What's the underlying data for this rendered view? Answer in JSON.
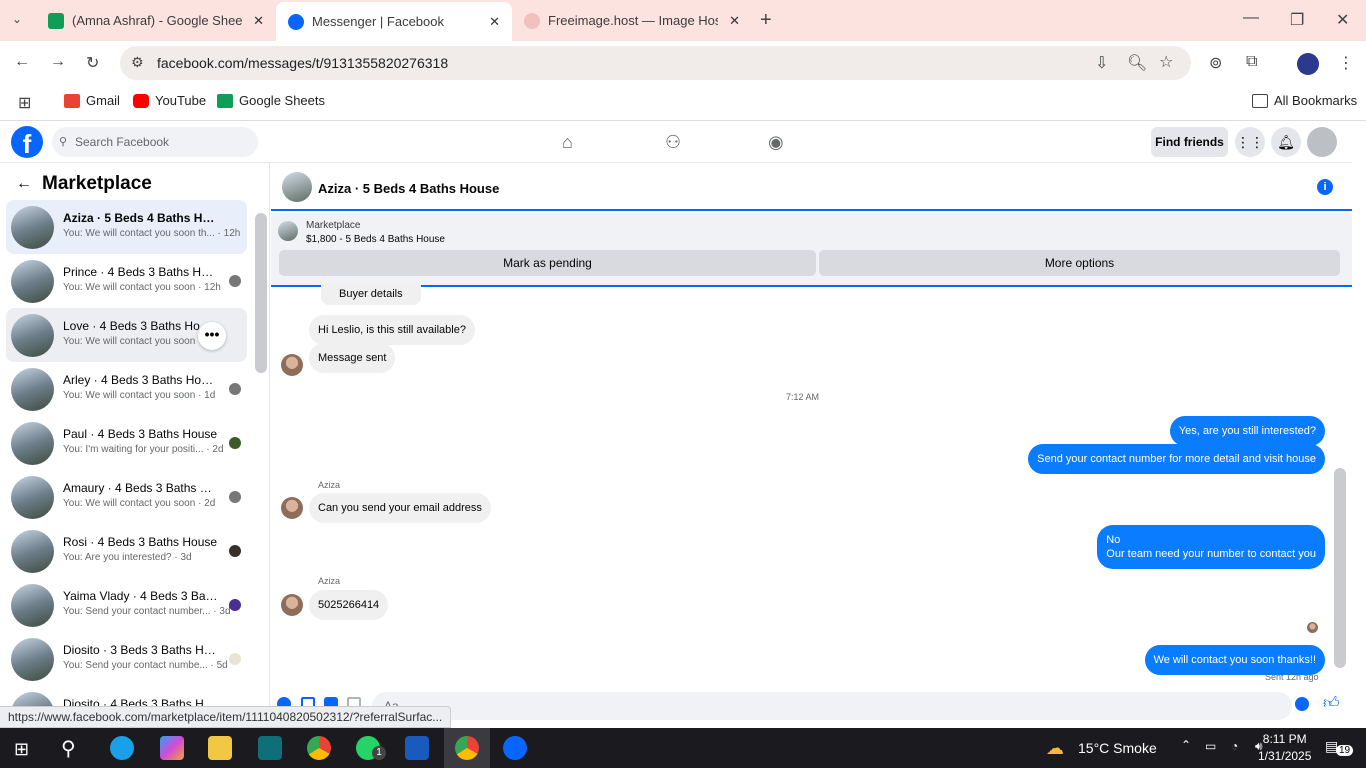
{
  "browser": {
    "tabs": [
      {
        "title": "(Amna Ashraf) - Google Sheets",
        "favicon_color": "#0f9d58"
      },
      {
        "title": "Messenger | Facebook",
        "favicon_color": "#0866ff"
      },
      {
        "title": "Freeimage.host — Image Hostin",
        "favicon_color": "#e57373"
      }
    ],
    "new_tab": "+",
    "url": "facebook.com/messages/t/9131355820276318",
    "bookmarks": [
      {
        "label": "Gmail"
      },
      {
        "label": "YouTube"
      },
      {
        "label": "Google Sheets"
      }
    ],
    "all_bookmarks": "All Bookmarks",
    "status_url": "https://www.facebook.com/marketplace/item/1111040820502312/?referralSurfac..."
  },
  "facebook": {
    "logo": "f",
    "search_placeholder": "Search Facebook",
    "find_friends": "Find friends"
  },
  "marketplace": {
    "title": "Marketplace",
    "conversations": [
      {
        "name": "Aziza · 5 Beds 4 Baths House",
        "snippet": "You: We will contact you soon th... · 12h"
      },
      {
        "name": "Prince · 4 Beds 3 Baths House",
        "snippet": "You: We will contact you soon · 12h"
      },
      {
        "name": "Love · 4 Beds 3 Baths House",
        "snippet": "You: We will contact you soon · 1..."
      },
      {
        "name": "Arley · 4 Beds 3 Baths House",
        "snippet": "You: We will contact you soon · 1d"
      },
      {
        "name": "Paul · 4 Beds 3 Baths House",
        "snippet": "You: I'm waiting for your positi... · 2d"
      },
      {
        "name": "Amaury · 4 Beds 3 Baths Ho...",
        "snippet": "You: We will contact you soon · 2d"
      },
      {
        "name": "Rosi · 4 Beds 3 Baths House",
        "snippet": "You: Are you interested? · 3d"
      },
      {
        "name": "Yaima Vlady · 4 Beds 3 Baths...",
        "snippet": "You: Send your contact number... · 3d"
      },
      {
        "name": "Diosito · 3 Beds 3 Baths House",
        "snippet": "You: Send your contact numbe... · 5d"
      },
      {
        "name": "Diosito · 4 Beds 3 Baths House",
        "snippet": ""
      }
    ],
    "more": "•••"
  },
  "chat": {
    "title": "Aziza · 5 Beds 4 Baths House",
    "info": "i",
    "listing_label": "Marketplace",
    "listing_price": "$1,800 - 5 Beds 4 Baths House",
    "mark_pending": "Mark as pending",
    "more_options": "More options",
    "buyer_details": "Buyer details",
    "time_divider": "7:12 AM",
    "sender_name": "Aziza",
    "messages": [
      {
        "dir": "in",
        "text": "Hi Leslio, is this still available?"
      },
      {
        "dir": "in",
        "text": "Message sent"
      },
      {
        "dir": "out",
        "text": "Yes, are you still interested?"
      },
      {
        "dir": "out",
        "text": "Send your contact number for more detail and visit house"
      },
      {
        "dir": "in",
        "text": "Can you send your email address"
      },
      {
        "dir": "out",
        "text": "No"
      },
      {
        "dir": "out",
        "text": "Our team need your number to contact you"
      },
      {
        "dir": "in",
        "text": "5025266414"
      },
      {
        "dir": "out",
        "text": "We will contact you soon thanks!!"
      }
    ],
    "sent_status": "Sent 12h ago",
    "composer_placeholder": "Aa"
  },
  "taskbar": {
    "temperature": "15°C",
    "weather": "Smoke",
    "time": "8:11 PM",
    "date": "1/31/2025",
    "whatsapp_badge": "1",
    "notification_badge": "19"
  }
}
